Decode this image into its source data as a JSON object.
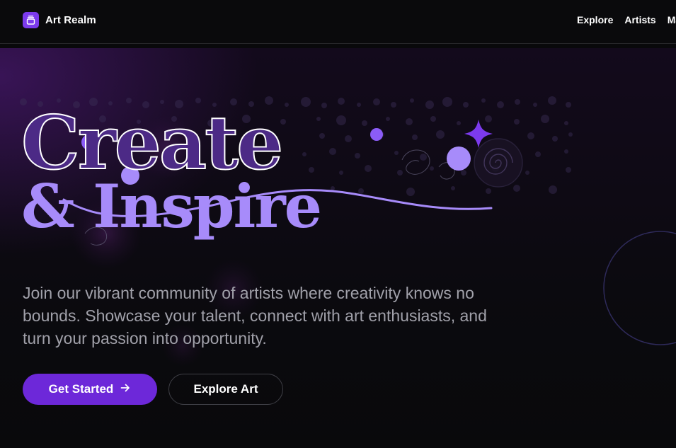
{
  "header": {
    "brand_name": "Art Realm",
    "brand_icon": "layers-icon",
    "nav": [
      "Explore",
      "Artists",
      "Ma"
    ]
  },
  "hero": {
    "headline_line1": "Create",
    "headline_line2": "& Inspire",
    "subtext": "Join our vibrant community of artists where creativity knows no bounds. Showcase your talent, connect with art enthusiasts, and turn your passion into opportunity.",
    "primary_button_label": "Get Started",
    "primary_button_icon": "arrow-right-icon",
    "secondary_button_label": "Explore Art"
  },
  "colors": {
    "accent": "#6d28d9",
    "accent_light": "#a78bfa",
    "background": "#09090b",
    "muted_text": "#a1a1aa"
  }
}
